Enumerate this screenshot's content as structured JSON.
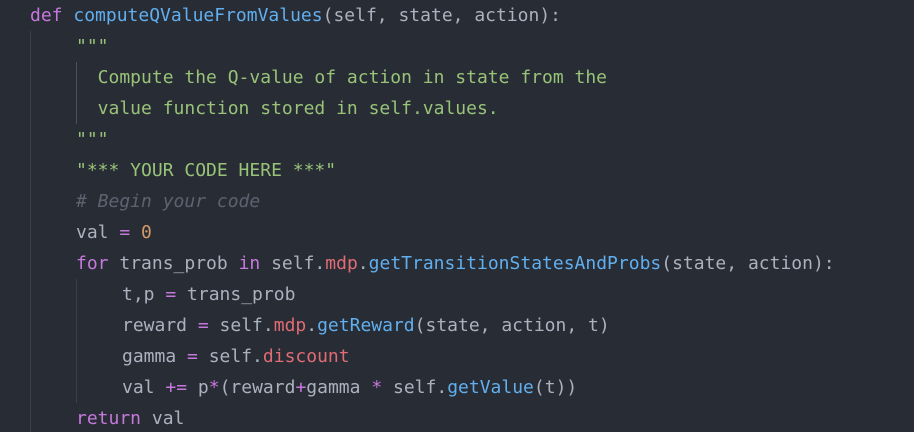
{
  "editor": {
    "language": "python",
    "colors": {
      "background": "#282c34",
      "keyword": "#c678dd",
      "function": "#61afef",
      "attribute": "#e06c75",
      "number": "#d19a66",
      "string": "#98c379",
      "comment": "#5c6370",
      "plain": "#abb2bf"
    },
    "lines": [
      {
        "indent": 0,
        "tokens": [
          {
            "t": "kw",
            "v": "def"
          },
          {
            "t": "pl",
            "v": " "
          },
          {
            "t": "fn",
            "v": "computeQValueFromValues"
          },
          {
            "t": "pl",
            "v": "(self, state, action):"
          }
        ]
      },
      {
        "indent": 1,
        "tokens": [
          {
            "t": "str",
            "v": "\"\"\""
          }
        ]
      },
      {
        "indent": 1,
        "tokens": [
          {
            "t": "str",
            "v": "  Compute the Q-value of action in state from the"
          }
        ]
      },
      {
        "indent": 1,
        "tokens": [
          {
            "t": "str",
            "v": "  value function stored in self.values."
          }
        ]
      },
      {
        "indent": 1,
        "tokens": [
          {
            "t": "str",
            "v": "\"\"\""
          }
        ]
      },
      {
        "indent": 1,
        "tokens": [
          {
            "t": "str",
            "v": "\"*** YOUR CODE HERE ***\""
          }
        ]
      },
      {
        "indent": 1,
        "tokens": [
          {
            "t": "cm",
            "v": "# Begin your code"
          }
        ]
      },
      {
        "indent": 1,
        "tokens": [
          {
            "t": "pl",
            "v": "val "
          },
          {
            "t": "op",
            "v": "="
          },
          {
            "t": "pl",
            "v": " "
          },
          {
            "t": "num",
            "v": "0"
          }
        ]
      },
      {
        "indent": 1,
        "tokens": [
          {
            "t": "kw",
            "v": "for"
          },
          {
            "t": "pl",
            "v": " trans_prob "
          },
          {
            "t": "kw",
            "v": "in"
          },
          {
            "t": "pl",
            "v": " self."
          },
          {
            "t": "attr",
            "v": "mdp"
          },
          {
            "t": "pl",
            "v": "."
          },
          {
            "t": "fn",
            "v": "getTransitionStatesAndProbs"
          },
          {
            "t": "pl",
            "v": "(state, action):"
          }
        ]
      },
      {
        "indent": 2,
        "tokens": [
          {
            "t": "pl",
            "v": "t,p "
          },
          {
            "t": "op",
            "v": "="
          },
          {
            "t": "pl",
            "v": " trans_prob"
          }
        ]
      },
      {
        "indent": 2,
        "tokens": [
          {
            "t": "pl",
            "v": "reward "
          },
          {
            "t": "op",
            "v": "="
          },
          {
            "t": "pl",
            "v": " self."
          },
          {
            "t": "attr",
            "v": "mdp"
          },
          {
            "t": "pl",
            "v": "."
          },
          {
            "t": "fn",
            "v": "getReward"
          },
          {
            "t": "pl",
            "v": "(state, action, t)"
          }
        ]
      },
      {
        "indent": 2,
        "tokens": [
          {
            "t": "pl",
            "v": "gamma "
          },
          {
            "t": "op",
            "v": "="
          },
          {
            "t": "pl",
            "v": " self."
          },
          {
            "t": "attr",
            "v": "discount"
          }
        ]
      },
      {
        "indent": 2,
        "tokens": [
          {
            "t": "pl",
            "v": "val "
          },
          {
            "t": "op",
            "v": "+="
          },
          {
            "t": "pl",
            "v": " p"
          },
          {
            "t": "op",
            "v": "*"
          },
          {
            "t": "pl",
            "v": "(reward"
          },
          {
            "t": "op",
            "v": "+"
          },
          {
            "t": "pl",
            "v": "gamma "
          },
          {
            "t": "op",
            "v": "*"
          },
          {
            "t": "pl",
            "v": " self."
          },
          {
            "t": "fn",
            "v": "getValue"
          },
          {
            "t": "pl",
            "v": "(t))"
          }
        ]
      },
      {
        "indent": 1,
        "tokens": [
          {
            "t": "kw",
            "v": "return"
          },
          {
            "t": "pl",
            "v": " val"
          }
        ]
      }
    ]
  }
}
